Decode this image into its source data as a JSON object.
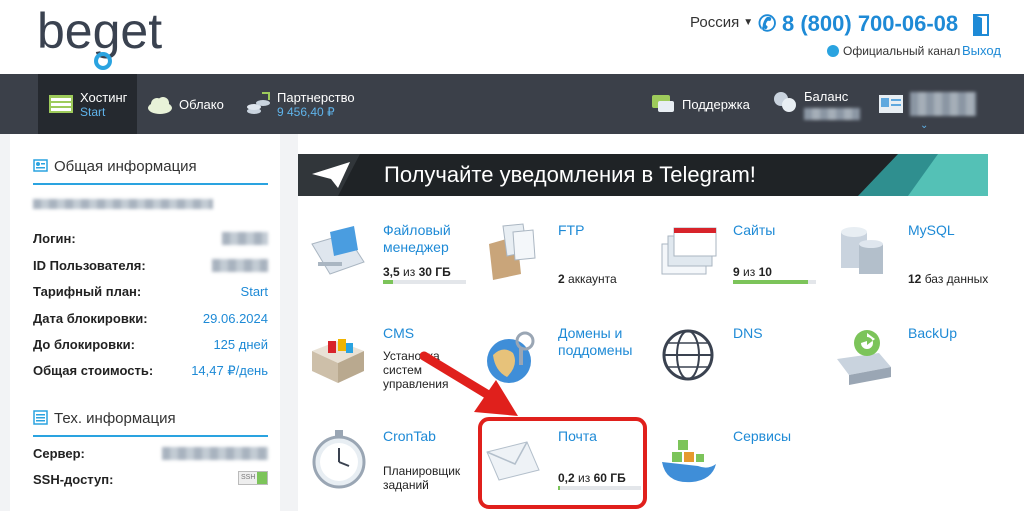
{
  "header": {
    "logo_text": "beget",
    "region": "Россия",
    "phone": "8 (800) 700-06-08",
    "channel_link": "Официальный канал",
    "exit_link": "Выход"
  },
  "nav": {
    "hosting": {
      "label": "Хостинг",
      "sub": "Start"
    },
    "cloud": {
      "label": "Облако"
    },
    "partner": {
      "label": "Партнерство",
      "sub": "9 456,40 ₽"
    },
    "support": {
      "label": "Поддержка"
    },
    "balance": {
      "label": "Баланс"
    }
  },
  "sidebar": {
    "general_title": "Общая информация",
    "rows": [
      {
        "key": "Логин:",
        "value": ""
      },
      {
        "key": "ID Пользователя:",
        "value": ""
      },
      {
        "key": "Тарифный план:",
        "value": "Start"
      },
      {
        "key": "Дата блокировки:",
        "value": "29.06.2024"
      },
      {
        "key": "До блокировки:",
        "value": "125 дней"
      },
      {
        "key": "Общая стоимость:",
        "value": "14,47 ₽/день"
      }
    ],
    "tech_title": "Тех. информация",
    "tech_rows": [
      {
        "key": "Сервер:",
        "value": ""
      },
      {
        "key": "SSH-доступ:",
        "value": "SSH"
      }
    ]
  },
  "banner": {
    "text": "Получайте уведомления в Telegram!"
  },
  "tiles": {
    "files": {
      "title": "Файловый менеджер",
      "used": "3,5",
      "of": "из",
      "total": "30 ГБ",
      "fill": 0.12
    },
    "ftp": {
      "title": "FTP",
      "count": "2",
      "label": "аккаунта"
    },
    "sites": {
      "title": "Сайты",
      "used": "9",
      "of": "из",
      "total": "10",
      "fill": 0.9
    },
    "mysql": {
      "title": "MySQL",
      "count": "12",
      "label": "баз данных"
    },
    "cms": {
      "title": "CMS",
      "desc": "Установка систем управления"
    },
    "domains": {
      "title": "Домены и поддомены"
    },
    "dns": {
      "title": "DNS"
    },
    "backup": {
      "title": "BackUp"
    },
    "cron": {
      "title": "CronTab",
      "desc": "Планировщик заданий"
    },
    "mail": {
      "title": "Почта",
      "used": "0,2",
      "of": "из",
      "total": "60 ГБ",
      "fill": 0.01
    },
    "services": {
      "title": "Сервисы"
    }
  },
  "colors": {
    "accent": "#1e8ad6",
    "navbar": "#3b4049",
    "progress": "#7cc45a",
    "highlight": "#e0201c"
  }
}
